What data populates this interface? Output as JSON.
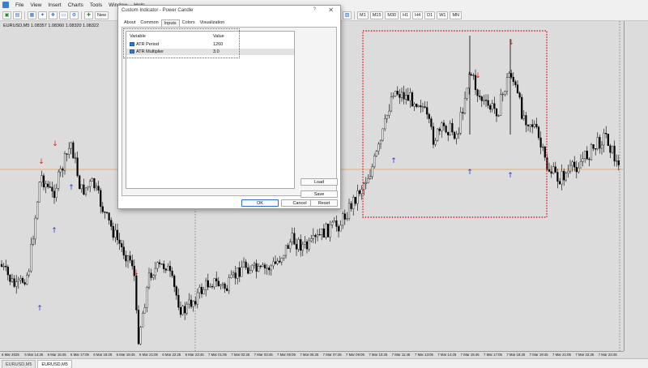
{
  "menu": {
    "items": [
      "File",
      "View",
      "Insert",
      "Charts",
      "Tools",
      "Window",
      "Help"
    ]
  },
  "toolbar": {
    "new_order_label": "New",
    "timeframes": [
      "M1",
      "M15",
      "M30",
      "H1",
      "H4",
      "D1",
      "W1",
      "MN"
    ]
  },
  "chart": {
    "title": "EURUSD,M5  1.08357 1.08360 1.08320 1.08322",
    "time_labels": [
      "6 Mar 2025",
      "6 Mar 14:25",
      "6 Mar 15:45",
      "6 Mar 17:05",
      "6 Mar 18:25",
      "6 Mar 19:45",
      "6 Mar 21:05",
      "6 Mar 22:25",
      "6 Mar 23:45",
      "7 Mar 01:05",
      "7 Mar 02:25",
      "7 Mar 03:45",
      "7 Mar 05:05",
      "7 Mar 06:25",
      "7 Mar 07:45",
      "7 Mar 09:05",
      "7 Mar 10:25",
      "7 Mar 11:45",
      "7 Mar 13:05",
      "7 Mar 14:25",
      "7 Mar 15:45",
      "7 Mar 17:05",
      "7 Mar 18:25",
      "7 Mar 19:45",
      "7 Mar 21:05",
      "7 Mar 22:25",
      "7 Mar 23:45"
    ],
    "colors": {
      "bull": "#ffffff",
      "bear": "#000000",
      "up_arrow": "#2a35d8",
      "down_arrow": "#d81f1f",
      "level_line": "#e8a04a",
      "highlight": "#e02020"
    }
  },
  "tabs": [
    "EURUSD,M5",
    "EURUSD,M5"
  ],
  "dialog": {
    "title": "Custom Indicator - Power Candle",
    "help": "?",
    "close": "✕",
    "tabs": [
      "About",
      "Common",
      "Inputs",
      "Colors",
      "Visualization"
    ],
    "active_tab": "Inputs",
    "table": {
      "col_variable": "Variable",
      "col_value": "Value",
      "rows": [
        {
          "variable": "ATR Period",
          "value": "1260"
        },
        {
          "variable": "ATR Multiplier",
          "value": "3.0"
        }
      ]
    },
    "load_label": "Load",
    "save_label": "Save",
    "ok_label": "OK",
    "cancel_label": "Cancel",
    "reset_label": "Reset"
  }
}
